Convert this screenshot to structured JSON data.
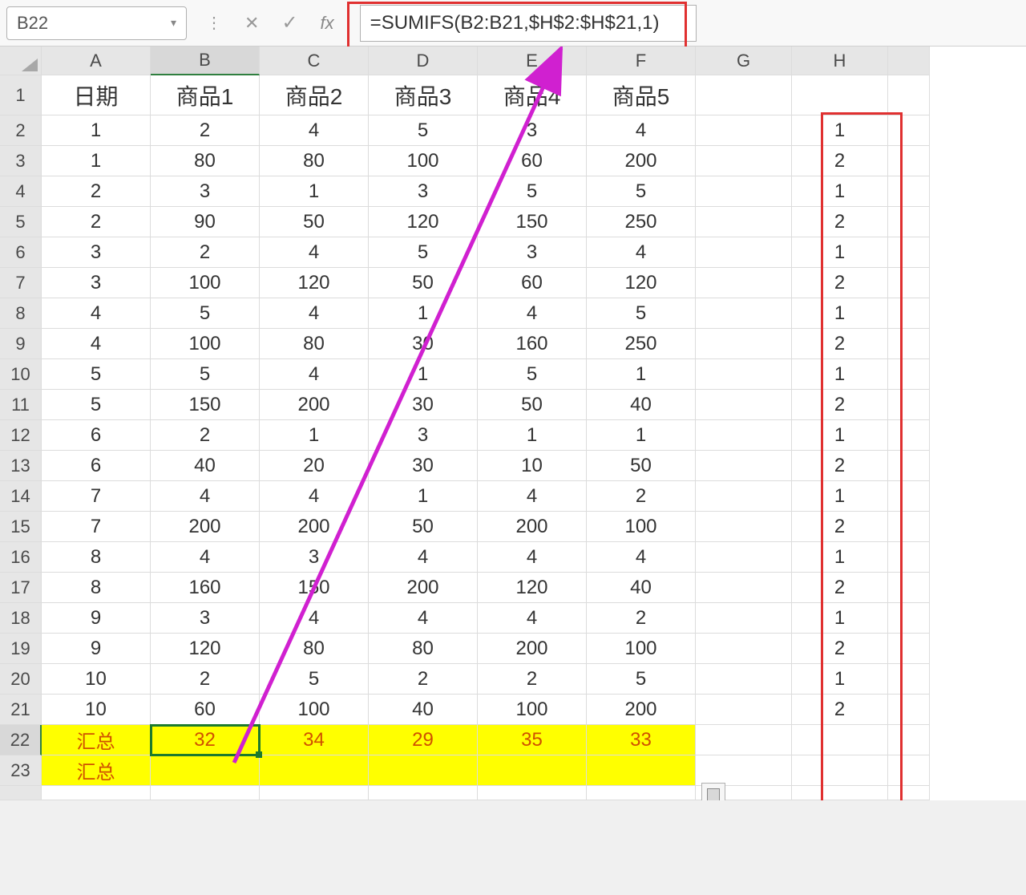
{
  "nameBox": {
    "value": "B22"
  },
  "formula": {
    "text": "=SUMIFS(B2:B21,$H$2:$H$21,1)"
  },
  "columns": [
    "A",
    "B",
    "C",
    "D",
    "E",
    "F",
    "G",
    "H"
  ],
  "rowNumbers": [
    1,
    2,
    3,
    4,
    5,
    6,
    7,
    8,
    9,
    10,
    11,
    12,
    13,
    14,
    15,
    16,
    17,
    18,
    19,
    20,
    21,
    22,
    23
  ],
  "headers": {
    "A": "日期",
    "B": "商品1",
    "C": "商品2",
    "D": "商品3",
    "E": "商品4",
    "F": "商品5"
  },
  "rows": [
    {
      "A": "1",
      "B": "2",
      "C": "4",
      "D": "5",
      "E": "3",
      "F": "4",
      "H": "1"
    },
    {
      "A": "1",
      "B": "80",
      "C": "80",
      "D": "100",
      "E": "60",
      "F": "200",
      "H": "2"
    },
    {
      "A": "2",
      "B": "3",
      "C": "1",
      "D": "3",
      "E": "5",
      "F": "5",
      "H": "1"
    },
    {
      "A": "2",
      "B": "90",
      "C": "50",
      "D": "120",
      "E": "150",
      "F": "250",
      "H": "2"
    },
    {
      "A": "3",
      "B": "2",
      "C": "4",
      "D": "5",
      "E": "3",
      "F": "4",
      "H": "1"
    },
    {
      "A": "3",
      "B": "100",
      "C": "120",
      "D": "50",
      "E": "60",
      "F": "120",
      "H": "2"
    },
    {
      "A": "4",
      "B": "5",
      "C": "4",
      "D": "1",
      "E": "4",
      "F": "5",
      "H": "1"
    },
    {
      "A": "4",
      "B": "100",
      "C": "80",
      "D": "30",
      "E": "160",
      "F": "250",
      "H": "2"
    },
    {
      "A": "5",
      "B": "5",
      "C": "4",
      "D": "1",
      "E": "5",
      "F": "1",
      "H": "1"
    },
    {
      "A": "5",
      "B": "150",
      "C": "200",
      "D": "30",
      "E": "50",
      "F": "40",
      "H": "2"
    },
    {
      "A": "6",
      "B": "2",
      "C": "1",
      "D": "3",
      "E": "1",
      "F": "1",
      "H": "1"
    },
    {
      "A": "6",
      "B": "40",
      "C": "20",
      "D": "30",
      "E": "10",
      "F": "50",
      "H": "2"
    },
    {
      "A": "7",
      "B": "4",
      "C": "4",
      "D": "1",
      "E": "4",
      "F": "2",
      "H": "1"
    },
    {
      "A": "7",
      "B": "200",
      "C": "200",
      "D": "50",
      "E": "200",
      "F": "100",
      "H": "2"
    },
    {
      "A": "8",
      "B": "4",
      "C": "3",
      "D": "4",
      "E": "4",
      "F": "4",
      "H": "1"
    },
    {
      "A": "8",
      "B": "160",
      "C": "150",
      "D": "200",
      "E": "120",
      "F": "40",
      "H": "2"
    },
    {
      "A": "9",
      "B": "3",
      "C": "4",
      "D": "4",
      "E": "4",
      "F": "2",
      "H": "1"
    },
    {
      "A": "9",
      "B": "120",
      "C": "80",
      "D": "80",
      "E": "200",
      "F": "100",
      "H": "2"
    },
    {
      "A": "10",
      "B": "2",
      "C": "5",
      "D": "2",
      "E": "2",
      "F": "5",
      "H": "1"
    },
    {
      "A": "10",
      "B": "60",
      "C": "100",
      "D": "40",
      "E": "100",
      "F": "200",
      "H": "2"
    }
  ],
  "sumRow": {
    "label": "汇总",
    "B": "32",
    "C": "34",
    "D": "29",
    "E": "35",
    "F": "33"
  },
  "sumRow2": {
    "label": "汇总"
  },
  "activeCell": "B22",
  "selectedCol": "B",
  "selectedRow": 22
}
